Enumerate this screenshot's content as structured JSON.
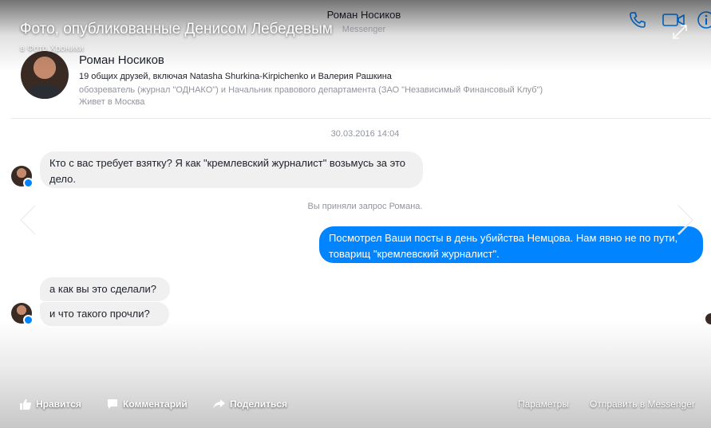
{
  "header": {
    "contact_name": "Роман Носиков",
    "subtitle": "Messenger"
  },
  "overlay": {
    "title": "Фото, опубликованные Денисом Лебедевым",
    "subtitle": "в Фото Хроники"
  },
  "profile": {
    "name": "Роман Носиков",
    "mutual_friends": "19 общих друзей, включая Natasha Shurkina-Kirpichenko и Валерия Рашкина",
    "job": "обозреватель (журнал \"ОДНАКО\") и Начальник правового департамента (ЗАО \"Независимый Финансовый Клуб\")",
    "location": "Живет в Москва"
  },
  "conversation": {
    "timestamp": "30.03.2016 14:04",
    "system_message": "Вы приняли запрос Романа.",
    "messages": [
      {
        "direction": "incoming",
        "text": "Кто с вас требует взятку? Я как \"кремлевский журналист\" возьмусь за это дело."
      },
      {
        "direction": "outgoing",
        "text": "Посмотрел Ваши посты в день убийства Немцова. Нам явно не по пути, товарищ \"кремлевский журналист\"."
      },
      {
        "direction": "incoming",
        "text": "а как вы это сделали?"
      },
      {
        "direction": "incoming",
        "text": "и что такого прочли?"
      }
    ]
  },
  "actions": {
    "like": "Нравится",
    "comment": "Комментарий",
    "share": "Поделиться",
    "options": "Параметры",
    "send_messenger": "Отправить в Messenger"
  },
  "colors": {
    "accent": "#0084ff",
    "bubble_incoming": "#f1f0f0"
  },
  "icons": [
    "phone-icon",
    "video-icon",
    "info-icon",
    "expand-icon",
    "like-icon",
    "comment-icon",
    "share-icon",
    "chevron-left-icon",
    "chevron-right-icon"
  ]
}
